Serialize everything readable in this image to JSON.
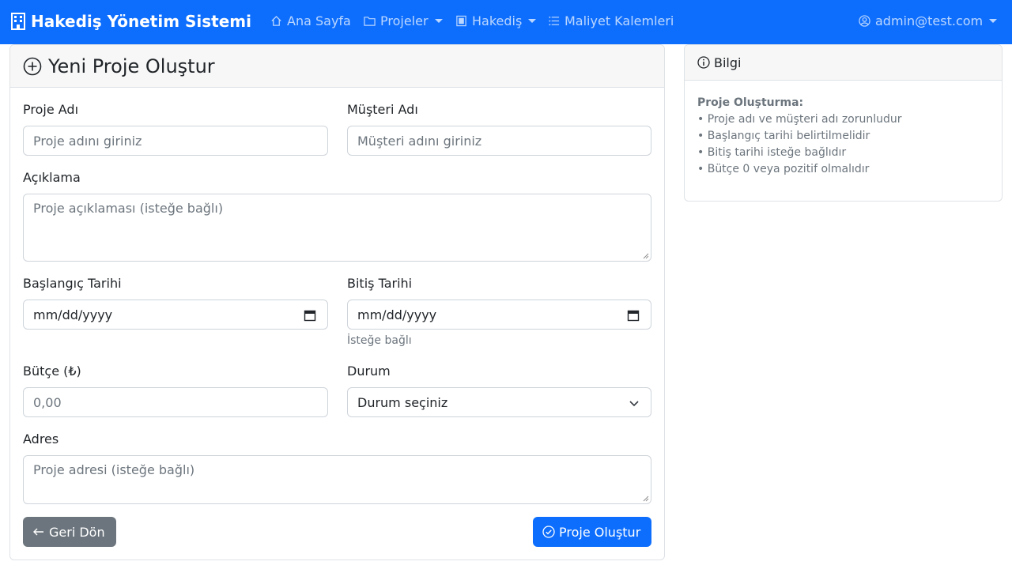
{
  "navbar": {
    "brand": "Hakediş Yönetim Sistemi",
    "items": [
      {
        "label": "Ana Sayfa"
      },
      {
        "label": "Projeler"
      },
      {
        "label": "Hakediş"
      },
      {
        "label": "Maliyet Kalemleri"
      }
    ],
    "user": "admin@test.com"
  },
  "form": {
    "title": "Yeni Proje Oluştur",
    "project_name": {
      "label": "Proje Adı",
      "placeholder": "Proje adını giriniz"
    },
    "customer_name": {
      "label": "Müşteri Adı",
      "placeholder": "Müşteri adını giriniz"
    },
    "description": {
      "label": "Açıklama",
      "placeholder": "Proje açıklaması (isteğe bağlı)"
    },
    "start_date": {
      "label": "Başlangıç Tarihi",
      "value": "mm/dd/yyyy"
    },
    "end_date": {
      "label": "Bitiş Tarihi",
      "value": "mm/dd/yyyy",
      "help": "İsteğe bağlı"
    },
    "budget": {
      "label": "Bütçe (₺)",
      "placeholder": "0,00"
    },
    "status": {
      "label": "Durum",
      "selected": "Durum seçiniz"
    },
    "address": {
      "label": "Adres",
      "placeholder": "Proje adresi (isteğe bağlı)"
    },
    "back_button": "Geri Dön",
    "create_button": "Proje Oluştur"
  },
  "info": {
    "title": "Bilgi",
    "heading": "Proje Oluşturma:",
    "lines": [
      "• Proje adı ve müşteri adı zorunludur",
      "• Başlangıç tarihi belirtilmelidir",
      "• Bitiş tarihi isteğe bağlıdır",
      "• Bütçe 0 veya pozitif olmalıdır"
    ]
  },
  "colors": {
    "primary": "#0d6efd",
    "secondary": "#6c757d"
  }
}
